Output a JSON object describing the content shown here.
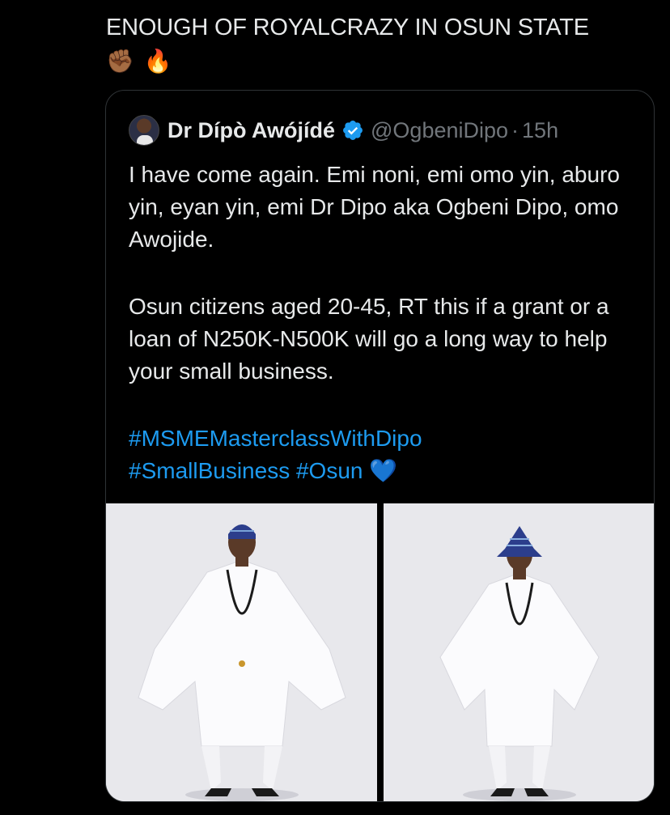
{
  "tweet": {
    "text": "ENOUGH OF ROYALCRAZY IN OSUN STATE",
    "emojis": [
      "✊🏾",
      "🔥"
    ]
  },
  "quoted_tweet": {
    "display_name": "Dr Dípò Awójídé",
    "handle": "@OgbeniDipo",
    "separator": "·",
    "time": "15h",
    "paragraph1": "I have come again. Emi noni, emi omo yin, aburo yin, eyan yin, emi Dr Dipo aka Ogbeni Dipo, omo Awojide.",
    "paragraph2": "Osun citizens aged 20-45, RT this if a grant or a loan of N250K-N500K will go a long way to help your small business.",
    "hashtags": [
      "#MSMEMasterclassWithDipo",
      "#SmallBusiness",
      "#Osun"
    ],
    "trailing_emoji": "💙",
    "icons": {
      "verified": "verified-badge-icon",
      "avatar": "profile-avatar"
    },
    "accent_color": "#1d9bf0"
  }
}
